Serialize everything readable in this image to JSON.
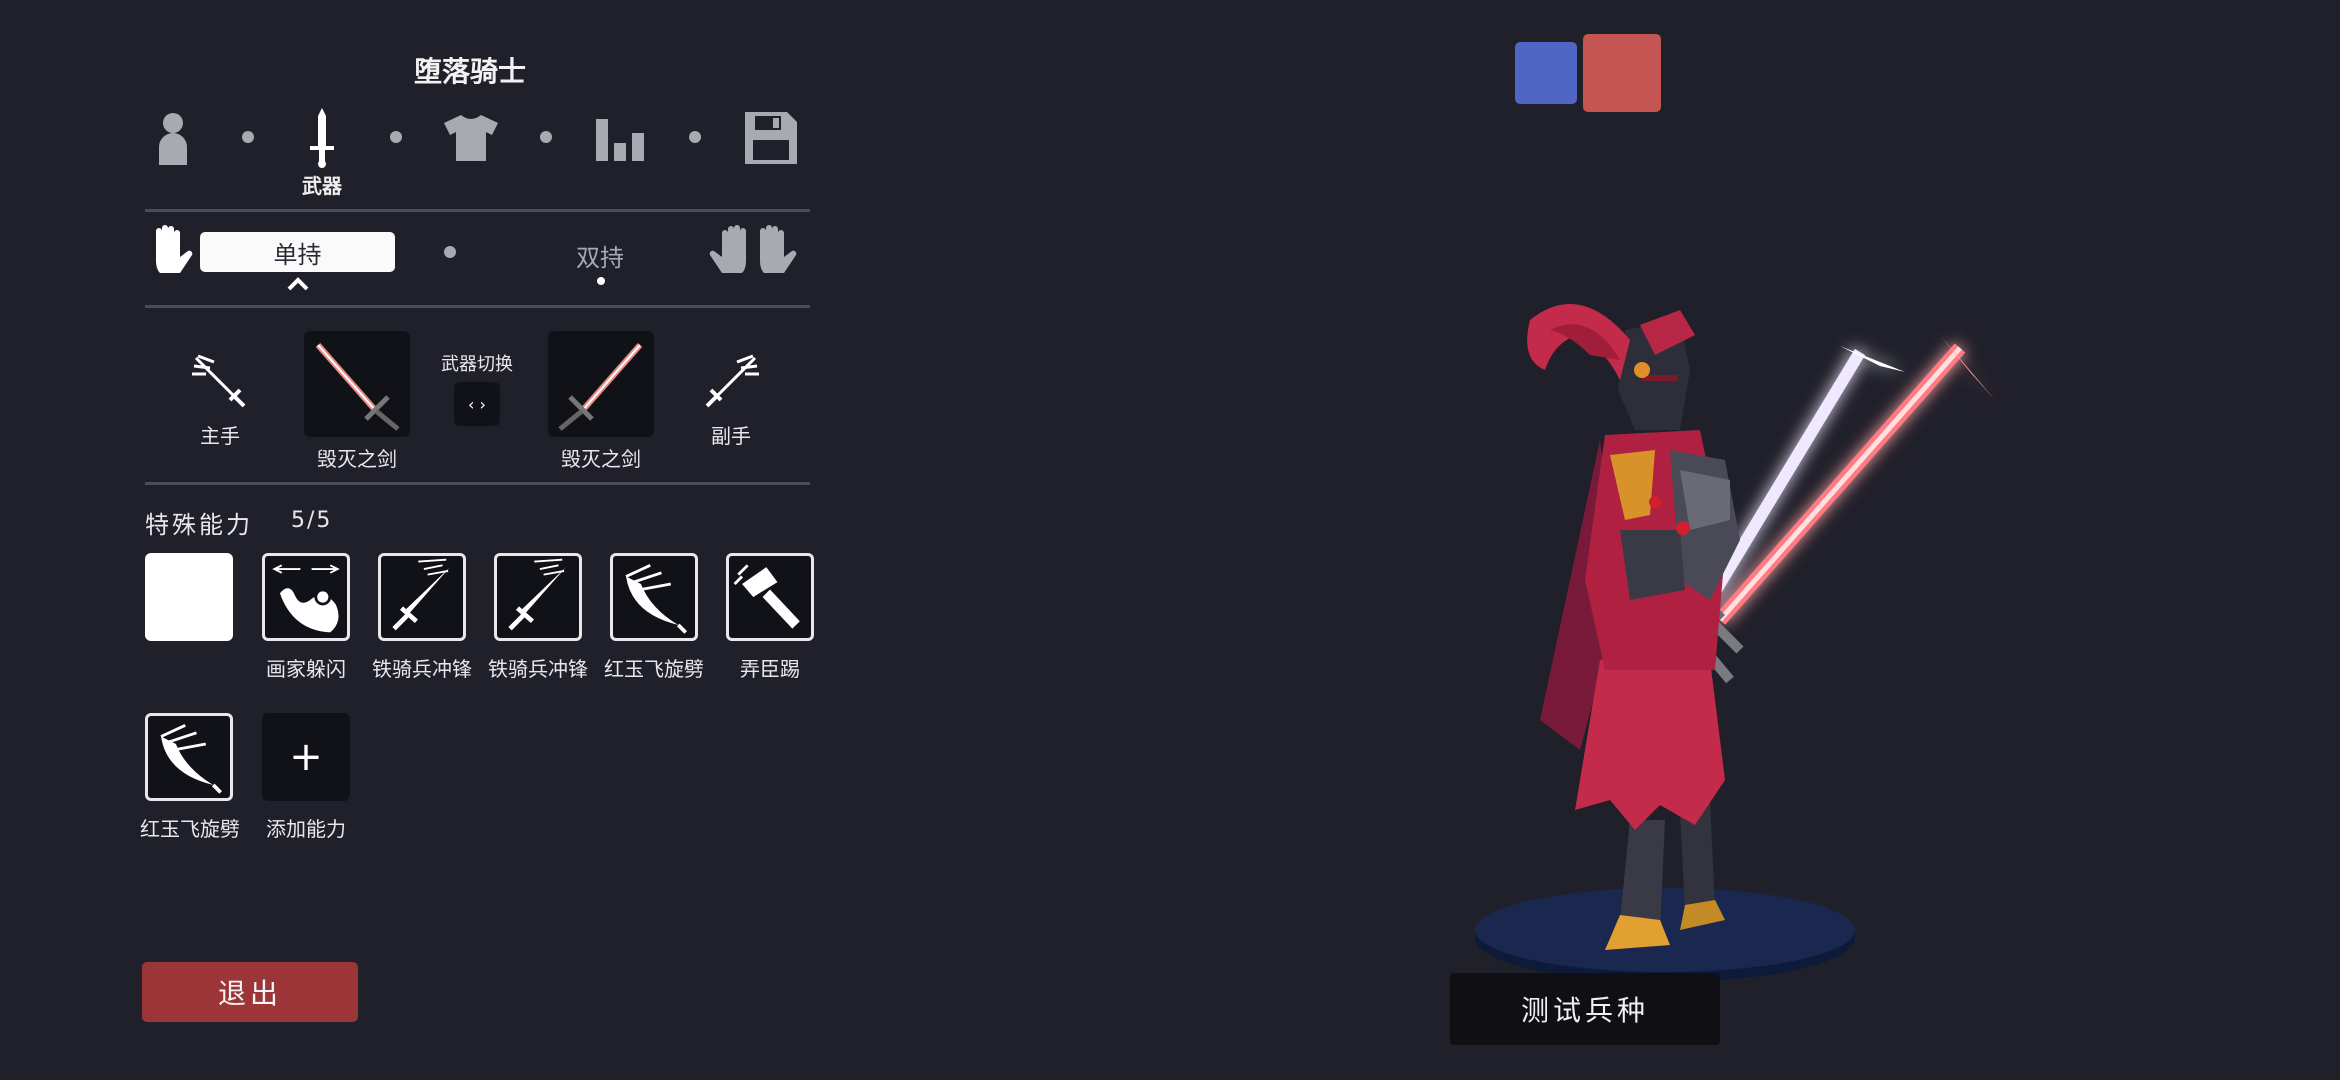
{
  "title": "堕落骑士",
  "steps": {
    "active_label": "武器"
  },
  "grip": {
    "single": "单持",
    "dual": "双持"
  },
  "weapons": {
    "main_hand_label": "主手",
    "off_hand_label": "副手",
    "slot1_name": "毁灭之剑",
    "slot2_name": "毁灭之剑",
    "swap_label": "武器切换",
    "swap_button": "‹ ›"
  },
  "abilities": {
    "header": "特殊能力",
    "count": "5/5",
    "items": [
      {
        "label": "画家躲闪"
      },
      {
        "label": "铁骑兵冲锋"
      },
      {
        "label": "铁骑兵冲锋"
      },
      {
        "label": "红玉飞旋劈"
      },
      {
        "label": "弄臣踢"
      },
      {
        "label": "红玉飞旋劈"
      }
    ],
    "add_label": "添加能力",
    "add_symbol": "+"
  },
  "exit_label": "退出",
  "test_label": "测试兵种",
  "colors": {
    "team_blue": "#5066c4",
    "team_red": "#c55552",
    "exit": "#9b3537",
    "background": "#20202a"
  }
}
